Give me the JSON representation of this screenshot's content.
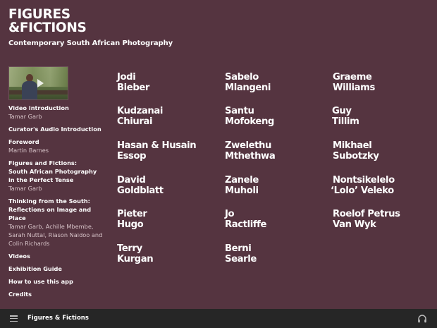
{
  "header": {
    "logo_line1": "FIGURES",
    "logo_line2": "&FICTIONS",
    "subtitle": "Contemporary South African Photography"
  },
  "video": {
    "icon": "play-icon"
  },
  "menu": {
    "items": [
      {
        "title": "Video introduction",
        "sub": "Tamar Garb"
      },
      {
        "title": "Curator's Audio Introduction",
        "sub": ""
      },
      {
        "title": "Foreword",
        "sub": "Martin Barnes"
      },
      {
        "title_lines": [
          "Figures and Fictions:",
          "South African Photography",
          "in the Perfect Tense"
        ],
        "sub": "Tamar Garb"
      },
      {
        "title_lines": [
          "Thinking from the South:",
          "Reflections on Image and Place"
        ],
        "sub_lines": [
          "Tamar Garb, Achille Mbembe,",
          "Sarah Nuttal, Riason Naidoo and",
          "Colin Richards"
        ]
      },
      {
        "title": "Videos"
      },
      {
        "title": "Exhibition Guide"
      },
      {
        "title": "How to use this app"
      },
      {
        "title": "Credits"
      }
    ]
  },
  "artists": [
    {
      "first": "Jodi",
      "last": "Bieber"
    },
    {
      "first": "Sabelo",
      "last": "Mlangeni"
    },
    {
      "first": "Graeme",
      "last": "Williams"
    },
    {
      "first": "Kudzanai",
      "last": "Chiurai"
    },
    {
      "first": "Santu",
      "last": "Mofokeng"
    },
    {
      "first": "Guy",
      "last": "Tillim"
    },
    {
      "first": "Hasan & Husain",
      "last": "Essop"
    },
    {
      "first": "Zwelethu",
      "last": "Mthethwa"
    },
    {
      "first": "Mikhael",
      "last": "Subotzky"
    },
    {
      "first": "David",
      "last": "Goldblatt"
    },
    {
      "first": "Zanele",
      "last": "Muholi"
    },
    {
      "first": "Nontsikelelo",
      "last": "‘Lolo’ Veleko"
    },
    {
      "first": "Pieter",
      "last": "Hugo"
    },
    {
      "first": "Jo",
      "last": "Ractliffe"
    },
    {
      "first": "Roelof Petrus",
      "last": "Van Wyk"
    },
    {
      "first": "Terry",
      "last": "Kurgan"
    },
    {
      "first": "Berni",
      "last": "Searle"
    }
  ],
  "bottombar": {
    "title": "Figures & Fictions",
    "menu_icon": "hamburger-icon",
    "audio_icon": "headphones-icon"
  },
  "colors": {
    "background": "#553440",
    "bottombar": "#262626",
    "subtext": "#d7c3c8"
  }
}
